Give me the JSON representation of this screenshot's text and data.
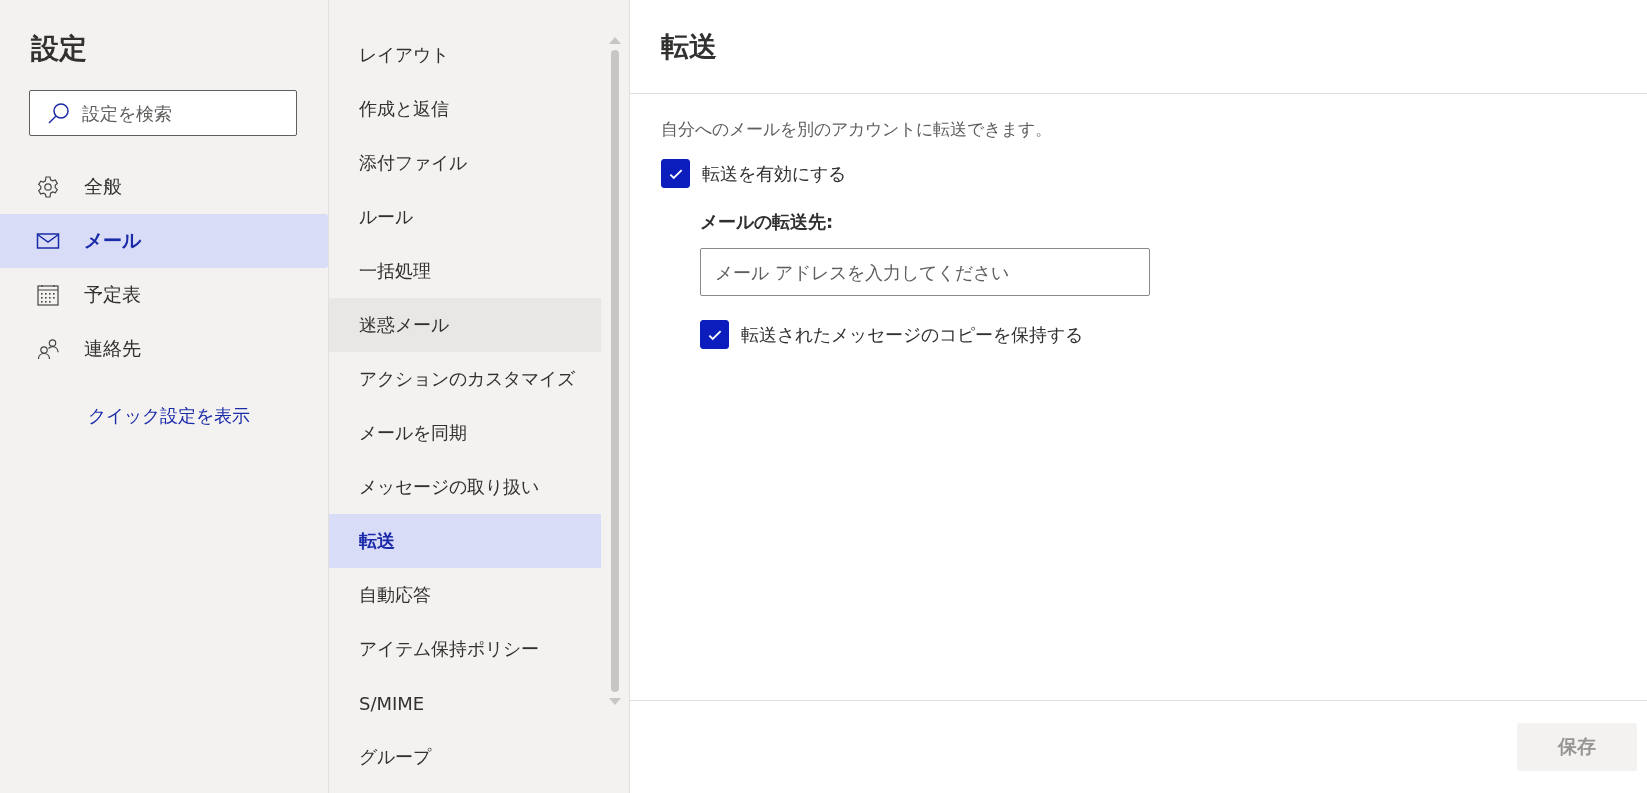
{
  "settings": {
    "title": "設定",
    "search": {
      "placeholder": "設定を検索"
    },
    "nav": [
      {
        "kind": "gear",
        "label": "全般",
        "selected": false
      },
      {
        "kind": "mail",
        "label": "メール",
        "selected": true
      },
      {
        "kind": "calendar",
        "label": "予定表",
        "selected": false
      },
      {
        "kind": "people",
        "label": "連絡先",
        "selected": false
      }
    ],
    "quick_link": "クイック設定を表示"
  },
  "submenu": {
    "items": [
      {
        "label": "レイアウト",
        "selected": false,
        "hovered": false
      },
      {
        "label": "作成と返信",
        "selected": false,
        "hovered": false
      },
      {
        "label": "添付ファイル",
        "selected": false,
        "hovered": false
      },
      {
        "label": "ルール",
        "selected": false,
        "hovered": false
      },
      {
        "label": "一括処理",
        "selected": false,
        "hovered": false
      },
      {
        "label": "迷惑メール",
        "selected": false,
        "hovered": true
      },
      {
        "label": "アクションのカスタマイズ",
        "selected": false,
        "hovered": false
      },
      {
        "label": "メールを同期",
        "selected": false,
        "hovered": false
      },
      {
        "label": "メッセージの取り扱い",
        "selected": false,
        "hovered": false
      },
      {
        "label": "転送",
        "selected": true,
        "hovered": false
      },
      {
        "label": "自動応答",
        "selected": false,
        "hovered": false
      },
      {
        "label": "アイテム保持ポリシー",
        "selected": false,
        "hovered": false
      },
      {
        "label": "S/MIME",
        "selected": false,
        "hovered": false
      },
      {
        "label": "グループ",
        "selected": false,
        "hovered": false
      }
    ]
  },
  "panel": {
    "title": "転送",
    "description": "自分へのメールを別のアカウントに転送できます。",
    "enable": {
      "label": "転送を有効にする",
      "checked": true
    },
    "forward_to": {
      "label": "メールの転送先:",
      "placeholder": "メール アドレスを入力してください"
    },
    "keep_copy": {
      "label": "転送されたメッセージのコピーを保持する",
      "checked": true
    },
    "save": {
      "label": "保存",
      "disabled": true
    }
  }
}
